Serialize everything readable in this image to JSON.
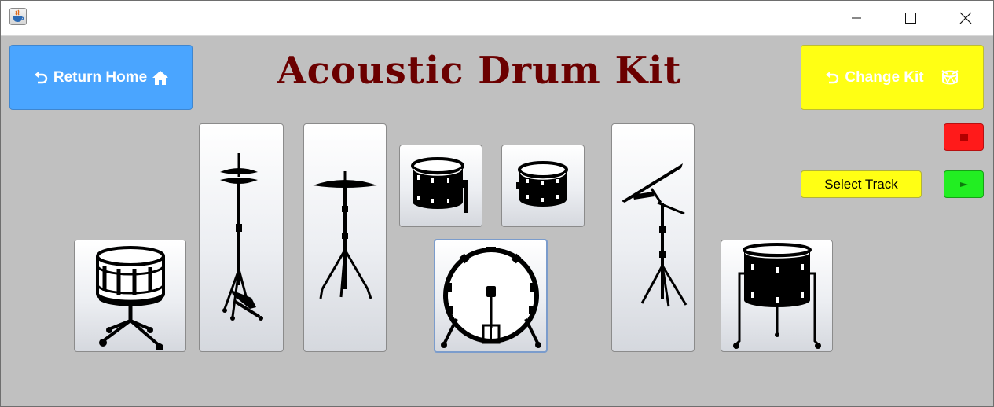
{
  "window": {
    "app_icon": "java-cup-icon",
    "controls": [
      "minimize-icon",
      "maximize-icon",
      "close-icon"
    ]
  },
  "header": {
    "title": "Acoustic Drum Kit",
    "home_button": {
      "label": "Return Home",
      "left_icon": "undo-arrow-icon",
      "right_icon": "home-icon"
    },
    "kit_button": {
      "label": "Change Kit",
      "left_icon": "undo-arrow-icon",
      "right_icon": "drum-icon"
    }
  },
  "controls": {
    "select_track_label": "Select Track",
    "stop_icon": "stop-icon",
    "play_icon": "play-icon"
  },
  "drums": [
    {
      "name": "snare-drum",
      "icon": "snare-drum-icon"
    },
    {
      "name": "hi-hat",
      "icon": "hi-hat-icon"
    },
    {
      "name": "ride-cymbal",
      "icon": "ride-cymbal-icon"
    },
    {
      "name": "high-tom",
      "icon": "high-tom-icon"
    },
    {
      "name": "mid-tom",
      "icon": "mid-tom-icon"
    },
    {
      "name": "bass-drum",
      "icon": "bass-drum-icon",
      "selected": true
    },
    {
      "name": "crash-cymbal",
      "icon": "crash-cymbal-icon"
    },
    {
      "name": "floor-tom",
      "icon": "floor-tom-icon"
    }
  ],
  "colors": {
    "background": "#c0c0c0",
    "home_button": "#4aa5ff",
    "kit_button": "#ffff14",
    "title": "#6b0000",
    "stop_button": "#ff1a1a",
    "play_button": "#22ee22",
    "track_button": "#ffff14"
  }
}
